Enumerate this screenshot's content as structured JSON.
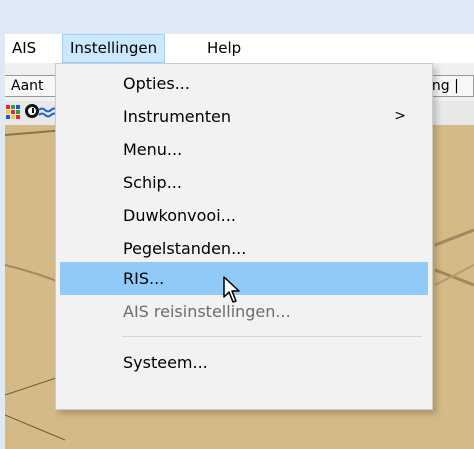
{
  "menubar": {
    "items": [
      {
        "label": "AIS"
      },
      {
        "label": "Instellingen"
      },
      {
        "label": "Help"
      }
    ]
  },
  "toolbar": {
    "tab_left_label": "Aant",
    "tab_right_label": "ing |"
  },
  "dropdown": {
    "items": [
      {
        "label": "Opties..."
      },
      {
        "label": "Instrumenten",
        "submenu_arrow": ">"
      },
      {
        "label": "Menu..."
      },
      {
        "label": "Schip..."
      },
      {
        "label": "Duwkonvooi..."
      },
      {
        "label": "Pegelstanden..."
      },
      {
        "label": "RIS..."
      },
      {
        "label": "AIS reisinstellingen..."
      },
      {
        "label": "Systeem..."
      }
    ]
  },
  "colors": {
    "menu_highlight": "#91c9f7",
    "active_menubar": "#cce8ff",
    "map_background": "#d4ba86",
    "window_background": "#dfe9f5"
  },
  "icons": [
    "grid-icon",
    "clock-icon",
    "wave-icon",
    "mouse-cursor-icon",
    "submenu-arrow-icon"
  ]
}
